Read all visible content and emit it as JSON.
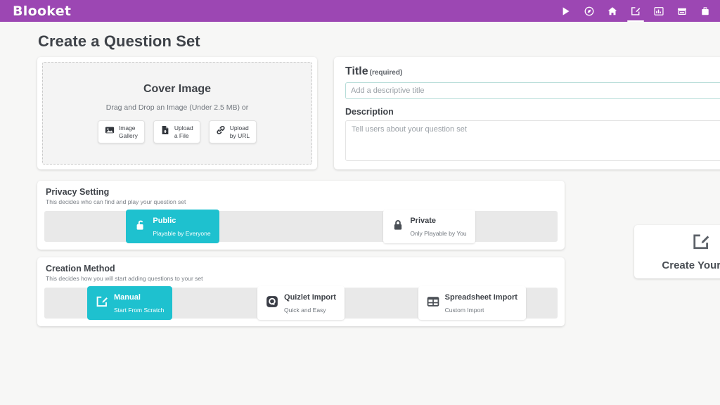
{
  "navbar": {
    "brand": "Blooket",
    "brand_color": "#9c47b3",
    "icons": [
      {
        "name": "play-icon",
        "label": "Play",
        "active": false
      },
      {
        "name": "discover-compass-icon",
        "label": "Discover",
        "active": false
      },
      {
        "name": "home-icon",
        "label": "Home",
        "active": false
      },
      {
        "name": "create-pencil-square-icon",
        "label": "Create",
        "active": true
      },
      {
        "name": "stats-chart-icon",
        "label": "Stats",
        "active": false
      },
      {
        "name": "market-shop-icon",
        "label": "Market",
        "active": false
      },
      {
        "name": "blooks-briefcase-icon",
        "label": "Blooks",
        "active": false
      }
    ]
  },
  "page": {
    "title": "Create a Question Set"
  },
  "cover": {
    "heading": "Cover Image",
    "subtext": "Drag and Drop an Image (Under 2.5 MB) or",
    "buttons": [
      {
        "icon": "image-gallery-icon",
        "line1": "Image",
        "line2": "Gallery"
      },
      {
        "icon": "file-upload-icon",
        "line1": "Upload",
        "line2": "a File"
      },
      {
        "icon": "link-url-icon",
        "line1": "Upload",
        "line2": "by URL"
      }
    ]
  },
  "meta": {
    "title_label": "Title",
    "title_required": "(required)",
    "title_value": "",
    "title_placeholder": "Add a descriptive title",
    "description_label": "Description",
    "description_value": "",
    "description_placeholder": "Tell users about your question set"
  },
  "privacy": {
    "heading": "Privacy Setting",
    "subheading": "This decides who can find and play your question set",
    "selected": "Public",
    "accent_color": "#1ec1cf",
    "options": [
      {
        "icon": "unlock-icon",
        "name": "Public",
        "desc": "Playable by Everyone",
        "selected": true
      },
      {
        "icon": "lock-icon",
        "name": "Private",
        "desc": "Only Playable by You",
        "selected": false
      }
    ]
  },
  "method": {
    "heading": "Creation Method",
    "subheading": "This decides how you will start adding questions to your set",
    "selected": "Manual",
    "options": [
      {
        "icon": "pencil-square-icon",
        "name": "Manual",
        "desc": "Start From Scratch",
        "selected": true
      },
      {
        "icon": "quizlet-logo-icon",
        "name": "Quizlet Import",
        "desc": "Quick and Easy",
        "selected": false
      },
      {
        "icon": "spreadsheet-grid-icon",
        "name": "Spreadsheet Import",
        "desc": "Custom Import",
        "selected": false
      }
    ]
  },
  "create_action": {
    "icon": "pencil-square-icon",
    "label": "Create Your Set"
  }
}
